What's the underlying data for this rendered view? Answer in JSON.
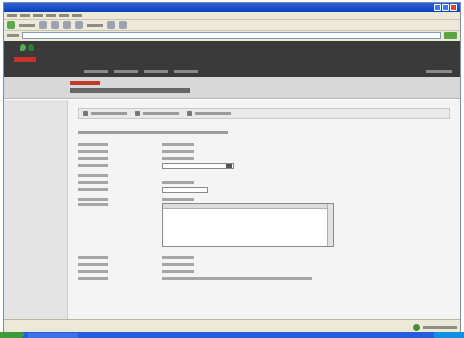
{
  "window": {
    "title": ""
  },
  "address": {
    "value": ""
  },
  "header": {
    "nav": [
      "",
      "",
      "",
      ""
    ],
    "right": ""
  },
  "title_band": {
    "breadcrumb": "",
    "title": ""
  },
  "actions": [
    "",
    "",
    ""
  ],
  "form": {
    "intro": "",
    "rows": [
      "",
      "",
      "",
      "",
      "",
      "",
      "",
      ""
    ],
    "select_value": "",
    "textarea_label": "",
    "textarea_value": "",
    "footer_rows": [
      "",
      "",
      "",
      ""
    ]
  },
  "status": {
    "text": "",
    "zone": ""
  }
}
